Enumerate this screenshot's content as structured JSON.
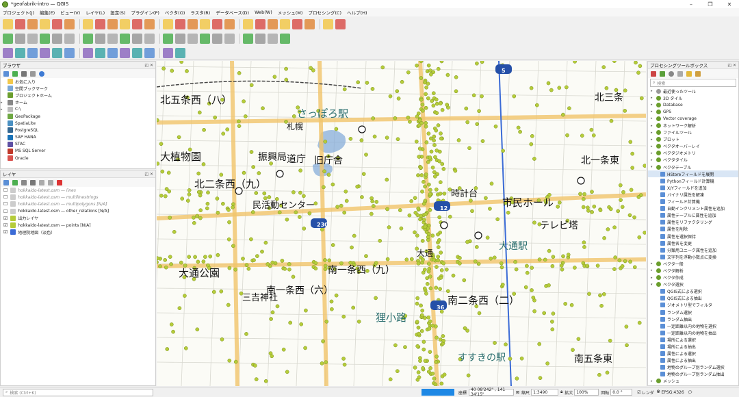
{
  "window": {
    "title": "*geofabrik-intro — QGIS",
    "minimize": "–",
    "maximize": "❐",
    "close": "✕"
  },
  "menu": [
    "プロジェクト(J)",
    "編集(E)",
    "ビュー(V)",
    "レイヤ(L)",
    "設定(S)",
    "プラグイン(P)",
    "ベクタ(O)",
    "ラスタ(R)",
    "データベース(D)",
    "Web(W)",
    "メッシュ(M)",
    "プロセシング(C)",
    "ヘルプ(H)"
  ],
  "browser": {
    "title": "ブラウザ",
    "items": [
      "お気に入り",
      "空間ブックマーク",
      "プロジェクトホーム",
      "ホーム",
      "C:\\",
      "GeoPackage",
      "SpatiaLite",
      "PostgreSQL",
      "SAP HANA",
      "STAC",
      "MS SQL Server",
      "Oracle"
    ]
  },
  "layers": {
    "title": "レイヤ",
    "items": [
      {
        "label": "hokkaido-latest.osm — lines",
        "checked": false,
        "muted": true
      },
      {
        "label": "hokkaido-latest.osm — multilinestrings",
        "checked": false,
        "muted": true
      },
      {
        "label": "hokkaido-latest.osm — multipolygons [N/A]",
        "checked": false,
        "muted": true
      },
      {
        "label": "hokkaido-latest.osm — other_relations [N/A]",
        "checked": false,
        "muted": false
      },
      {
        "label": "出力レイヤ",
        "checked": true,
        "muted": false
      },
      {
        "label": "hokkaido-latest.osm — points [N/A]",
        "checked": true,
        "muted": false
      },
      {
        "label": "地理院地図（淡色）",
        "checked": true,
        "muted": false
      }
    ]
  },
  "map_labels": [
    "北五条西（八）",
    "さっぽろ駅",
    "北三条",
    "大植物園",
    "振興局",
    "道庁",
    "旧庁舎",
    "北一条東",
    "北二条西（九）",
    "市民ホール",
    "時計台",
    "民活動センター",
    "テレビ塔",
    "大通駅",
    "大通公園",
    "南一条西（九）",
    "南一条西（六）",
    "三吉神社",
    "南二条西（二）",
    "狸小路",
    "すすきの駅",
    "南五条東",
    "大通",
    "札幌",
    "230",
    "36",
    "12",
    "5"
  ],
  "toolbox": {
    "title": "プロセシングツールボックス",
    "search_placeholder": "検索",
    "items": [
      {
        "label": "最近使ったツール",
        "level": 0,
        "kind": "clock"
      },
      {
        "label": "3D タイル",
        "level": 0,
        "kind": "group"
      },
      {
        "label": "Database",
        "level": 0,
        "kind": "group"
      },
      {
        "label": "GPS",
        "level": 0,
        "kind": "group"
      },
      {
        "label": "Vector coverage",
        "level": 0,
        "kind": "group"
      },
      {
        "label": "ネットワーク解析",
        "level": 0,
        "kind": "group"
      },
      {
        "label": "ファイルツール",
        "level": 0,
        "kind": "group"
      },
      {
        "label": "プロット",
        "level": 0,
        "kind": "group"
      },
      {
        "label": "ベクタオーバーレイ",
        "level": 0,
        "kind": "group"
      },
      {
        "label": "ベクタジオメトリ",
        "level": 0,
        "kind": "group"
      },
      {
        "label": "ベクタタイル",
        "level": 0,
        "kind": "group"
      },
      {
        "label": "ベクタテーブル",
        "level": 0,
        "kind": "group",
        "open": true
      },
      {
        "label": "HStoreフィールドを展開",
        "level": 1,
        "kind": "tool",
        "selected": true
      },
      {
        "label": "Pythonフィールド計算機",
        "level": 1,
        "kind": "tool"
      },
      {
        "label": "X/Yフィールドを追加",
        "level": 1,
        "kind": "tool"
      },
      {
        "label": "バイナリ属性を解凍",
        "level": 1,
        "kind": "tool"
      },
      {
        "label": "フィールド計算機",
        "level": 1,
        "kind": "tool"
      },
      {
        "label": "自動インクリメント属性を追加",
        "level": 1,
        "kind": "tool"
      },
      {
        "label": "属性テーブルに属性を追加",
        "level": 1,
        "kind": "tool"
      },
      {
        "label": "属性をリファクタリング",
        "level": 1,
        "kind": "tool"
      },
      {
        "label": "属性を削除",
        "level": 1,
        "kind": "tool"
      },
      {
        "label": "属性を選択保持",
        "level": 1,
        "kind": "tool"
      },
      {
        "label": "属性名を変更",
        "level": 1,
        "kind": "tool"
      },
      {
        "label": "分類用ユニーク属性を追加",
        "level": 1,
        "kind": "tool"
      },
      {
        "label": "文字列を浮動小数点に変換",
        "level": 1,
        "kind": "tool"
      },
      {
        "label": "ベクタ一般",
        "level": 0,
        "kind": "group"
      },
      {
        "label": "ベクタ解析",
        "level": 0,
        "kind": "group"
      },
      {
        "label": "ベクタ作成",
        "level": 0,
        "kind": "group"
      },
      {
        "label": "ベクタ選択",
        "level": 0,
        "kind": "group",
        "open": true
      },
      {
        "label": "QGIS式による選択",
        "level": 1,
        "kind": "tool"
      },
      {
        "label": "QGIS式による抽出",
        "level": 1,
        "kind": "tool"
      },
      {
        "label": "ジオメトリ型でフィルタ",
        "level": 1,
        "kind": "tool"
      },
      {
        "label": "ランダム選択",
        "level": 1,
        "kind": "tool"
      },
      {
        "label": "ランダム抽出",
        "level": 1,
        "kind": "tool"
      },
      {
        "label": "一定距離以内の地物を選択",
        "level": 1,
        "kind": "tool"
      },
      {
        "label": "一定距離以内の地物を抽出",
        "level": 1,
        "kind": "tool"
      },
      {
        "label": "場所による選択",
        "level": 1,
        "kind": "tool"
      },
      {
        "label": "場所による抽出",
        "level": 1,
        "kind": "tool"
      },
      {
        "label": "属性による選択",
        "level": 1,
        "kind": "tool"
      },
      {
        "label": "属性による抽出",
        "level": 1,
        "kind": "tool"
      },
      {
        "label": "地物のグループ別ランダム選択",
        "level": 1,
        "kind": "tool"
      },
      {
        "label": "地物のグループ別ランダム抽出",
        "level": 1,
        "kind": "tool"
      },
      {
        "label": "メッシュ",
        "level": 0,
        "kind": "group"
      }
    ]
  },
  "status": {
    "search_placeholder": "検索 (Ctrl+K)",
    "coord_label": "座標",
    "coord_value": "40 08'242\" , 141 34'15\"",
    "scale_label": "縮尺",
    "scale_value": "1:3490",
    "zoom_label": "拡大",
    "zoom_value": "100%",
    "rotation_label": "回転",
    "rotation_value": "0.0 °",
    "render_label": "レンダ",
    "crs_value": "EPSG:4326"
  },
  "colors": {
    "accent": "#1e88e5",
    "point": "#b5cc3a",
    "road": "#f1c46a",
    "water": "#7fa8d9",
    "rail": "#3b6bd6"
  }
}
